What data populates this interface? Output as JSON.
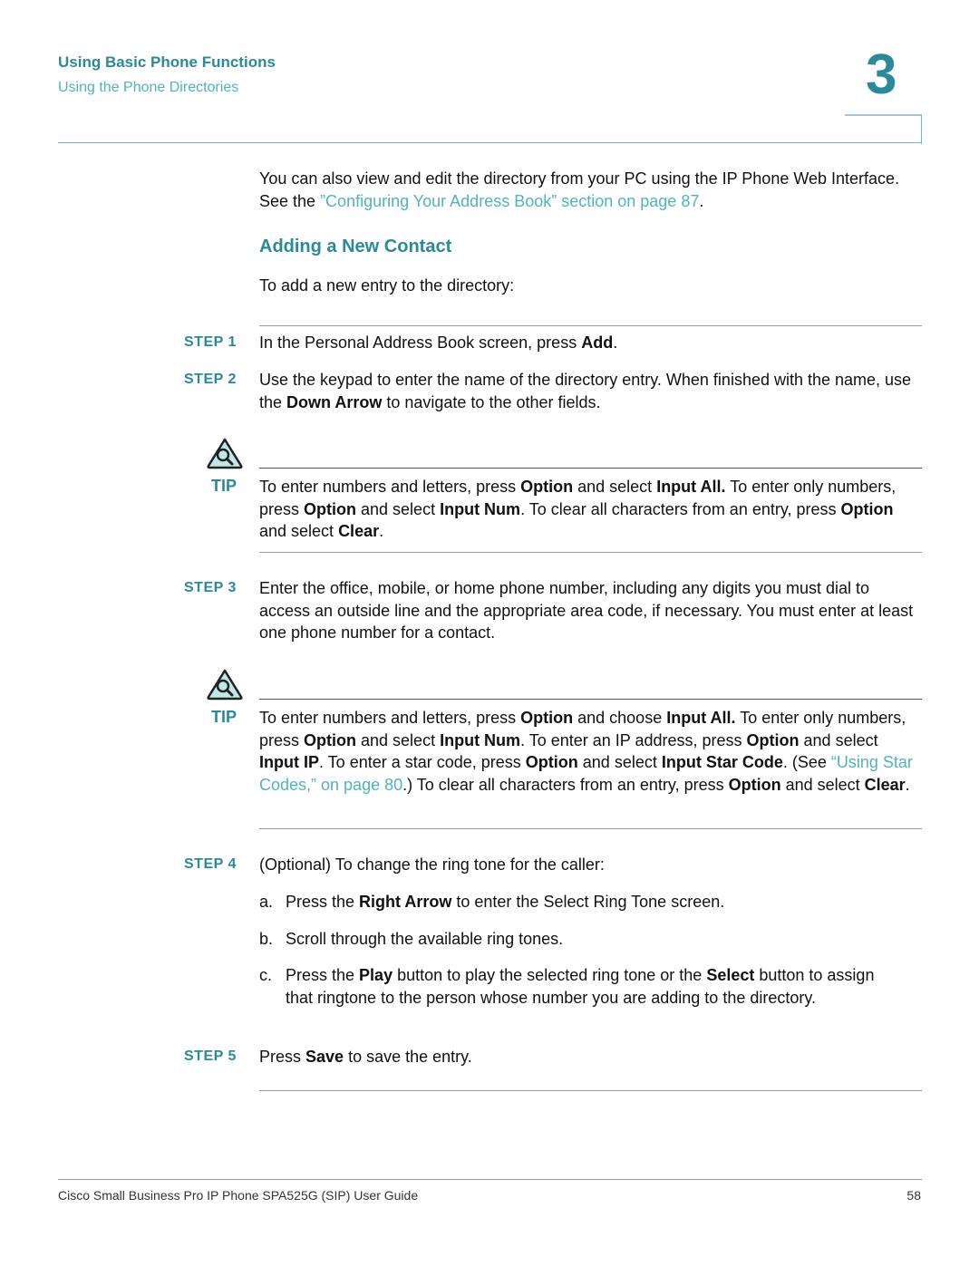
{
  "header": {
    "chapter_title": "Using Basic Phone Functions",
    "section_title": "Using the Phone Directories",
    "chapter_number": "3"
  },
  "intro": {
    "text_before": "You can also view and edit the directory from your PC using the IP Phone Web Interface. See the ",
    "link": "”Configuring Your Address Book” section on page 87",
    "text_after": "."
  },
  "section": {
    "heading": "Adding a New Contact",
    "lead": "To add a new entry to the directory:"
  },
  "steps": [
    {
      "label": "STEP 1",
      "parts": [
        [
          "In the Personal Address Book screen, press ",
          false
        ],
        [
          "Add",
          true
        ],
        [
          ".",
          false
        ]
      ]
    },
    {
      "label": "STEP 2",
      "parts": [
        [
          "Use the keypad to enter the name of the directory entry. When finished with the name, use the ",
          false
        ],
        [
          "Down Arrow",
          true
        ],
        [
          " to navigate to the other fields.",
          false
        ]
      ]
    },
    {
      "label": "STEP 3",
      "parts": [
        [
          "Enter the office, mobile, or home phone number, including any digits you must dial to access an outside line and the appropriate area code, if necessary. You must enter at least one phone number for a contact.",
          false
        ]
      ]
    },
    {
      "label": "STEP 4",
      "parts": [
        [
          "(Optional) To change the ring tone for the caller:",
          false
        ]
      ]
    },
    {
      "label": "STEP 5",
      "parts": [
        [
          "Press ",
          false
        ],
        [
          "Save",
          true
        ],
        [
          " to save the entry.",
          false
        ]
      ]
    }
  ],
  "tips": [
    {
      "label": "TIP",
      "icon": "tip-magnifier-icon",
      "parts": [
        [
          "To enter numbers and letters, press ",
          false
        ],
        [
          "Option",
          true
        ],
        [
          " and select ",
          false
        ],
        [
          "Input All.",
          true
        ],
        [
          " To enter only numbers, press ",
          false
        ],
        [
          "Option",
          true
        ],
        [
          " and select ",
          false
        ],
        [
          "Input Num",
          true
        ],
        [
          ". To clear all characters from an entry, press ",
          false
        ],
        [
          "Option",
          true
        ],
        [
          " and select ",
          false
        ],
        [
          "Clear",
          true
        ],
        [
          ".",
          false
        ]
      ]
    },
    {
      "label": "TIP",
      "icon": "tip-magnifier-icon",
      "parts": [
        [
          "To enter numbers and letters, press ",
          false
        ],
        [
          "Option",
          true
        ],
        [
          " and choose ",
          false
        ],
        [
          "Input All.",
          true
        ],
        [
          " To enter only numbers, press ",
          false
        ],
        [
          "Option",
          true
        ],
        [
          " and select ",
          false
        ],
        [
          "Input Num",
          true
        ],
        [
          ". To enter an IP address, press ",
          false
        ],
        [
          "Option",
          true
        ],
        [
          " and select ",
          false
        ],
        [
          "Input IP",
          true
        ],
        [
          ". To enter a star code, press ",
          false
        ],
        [
          "Option",
          true
        ],
        [
          " and select ",
          false
        ],
        [
          "Input Star Code",
          true
        ],
        [
          ". (See ",
          false
        ],
        [
          "“Using Star Codes,” on page 80",
          "link"
        ],
        [
          ".) To clear all characters from an entry, press ",
          false
        ],
        [
          "Option",
          true
        ],
        [
          " and select ",
          false
        ],
        [
          "Clear",
          true
        ],
        [
          ".",
          false
        ]
      ]
    }
  ],
  "substeps": [
    {
      "letter": "a.",
      "parts": [
        [
          "Press the ",
          false
        ],
        [
          "Right Arrow",
          true
        ],
        [
          " to enter the Select Ring Tone screen.",
          false
        ]
      ]
    },
    {
      "letter": "b.",
      "parts": [
        [
          "Scroll through the available ring tones.",
          false
        ]
      ]
    },
    {
      "letter": "c.",
      "parts": [
        [
          "Press the ",
          false
        ],
        [
          "Play",
          true
        ],
        [
          " button to play the selected ring tone or the ",
          false
        ],
        [
          "Select",
          true
        ],
        [
          " button to assign that ringtone to the person whose number you are adding to the directory.",
          false
        ]
      ]
    }
  ],
  "footer": {
    "title": "Cisco Small Business Pro IP Phone SPA525G (SIP) User Guide",
    "page": "58"
  },
  "colors": {
    "accent": "#2a8a9a",
    "link": "#4fb3bf"
  }
}
